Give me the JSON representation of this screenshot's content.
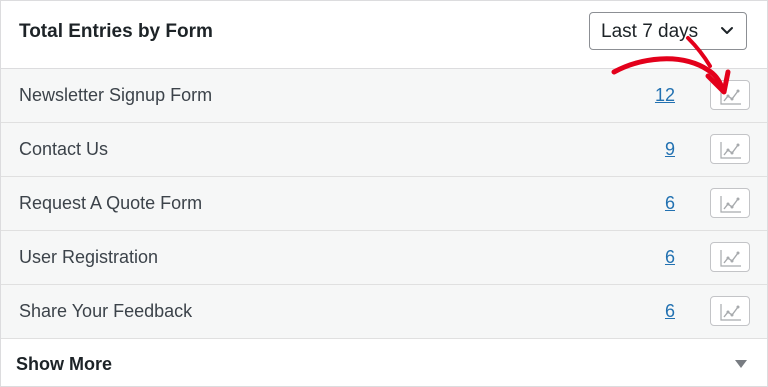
{
  "header": {
    "title": "Total Entries by Form",
    "period_select": {
      "selected": "Last 7 days"
    }
  },
  "forms": [
    {
      "name": "Newsletter Signup Form",
      "entries": "12"
    },
    {
      "name": "Contact Us",
      "entries": "9"
    },
    {
      "name": "Request A Quote Form",
      "entries": "6"
    },
    {
      "name": "User Registration",
      "entries": "6"
    },
    {
      "name": "Share Your Feedback",
      "entries": "6"
    }
  ],
  "footer": {
    "show_more_label": "Show More"
  },
  "colors": {
    "link": "#2271b1",
    "annotation": "#e3001b",
    "row_bg": "#f6f7f7"
  },
  "icons": {
    "row_action": "line-chart-icon",
    "select": "chevron-down-icon",
    "footer": "caret-down-icon"
  }
}
